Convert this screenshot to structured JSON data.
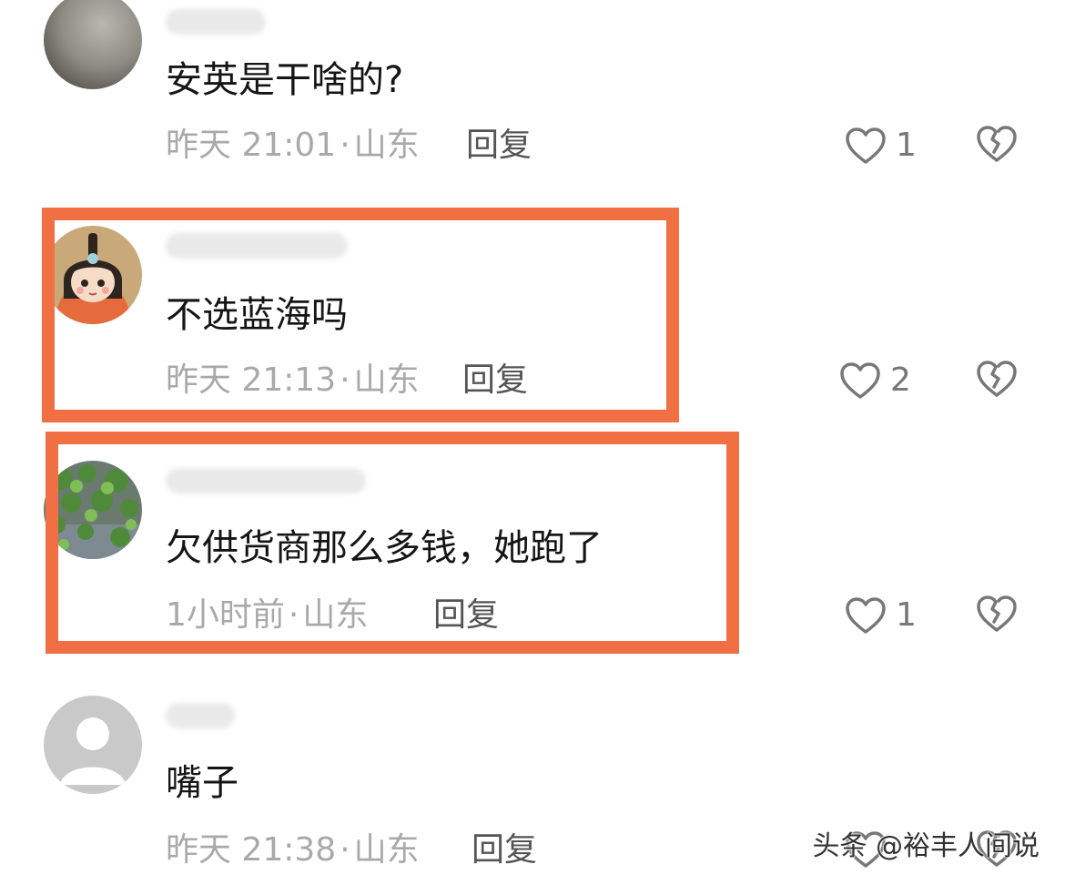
{
  "comments": [
    {
      "text": "安英是干啥的?",
      "time": "昨天 21:01",
      "sep": "·",
      "location": "山东",
      "reply": "回复",
      "likes": "1",
      "avatar": "gray-blur-photo"
    },
    {
      "text": "不选蓝海吗",
      "time": "昨天 21:13",
      "sep": "·",
      "location": "山东",
      "reply": "回复",
      "likes": "2",
      "avatar": "cartoon-girl-avatar"
    },
    {
      "text": "欠供货商那么多钱，她跑了",
      "time": "1小时前",
      "sep": "·",
      "location": "山东",
      "reply": "回复",
      "likes": "1",
      "avatar": "ivy-leaves-avatar"
    },
    {
      "text": "嘴子",
      "time": "昨天 21:38",
      "sep": "·",
      "location": "山东",
      "reply": "回复",
      "likes": "",
      "avatar": "default-user-avatar"
    }
  ],
  "watermark": "头条 @裕丰人间说",
  "colors": {
    "highlight": "#f07044",
    "meta": "#a9a9a9",
    "text": "#151515"
  }
}
